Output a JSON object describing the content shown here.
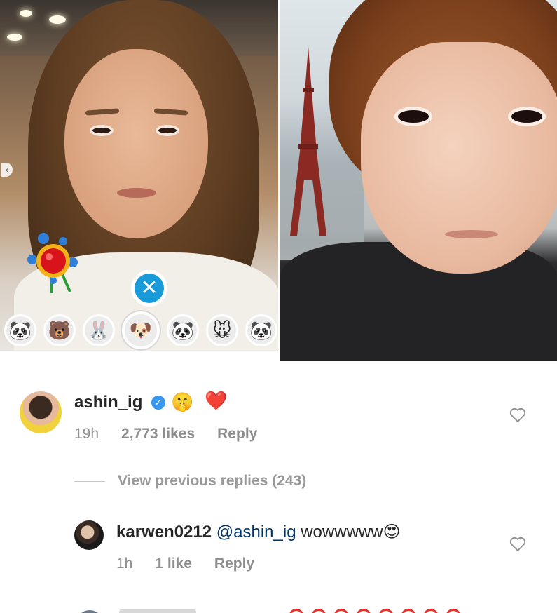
{
  "photos": {
    "left_alt": "",
    "filter_tray": {
      "chips": [
        "🐼",
        "🐻",
        "🐰",
        "🐶",
        "🐼",
        "🐭",
        "🐼"
      ],
      "selected_index": 3
    },
    "close_glyph": "✕",
    "chevron_glyph": "‹"
  },
  "main_comment": {
    "username": "ashin_ig",
    "verified_glyph": "✓",
    "emojis": [
      "🤫",
      "❤️"
    ],
    "time": "19h",
    "likes": "2,773 likes",
    "reply_label": "Reply",
    "like_icon": "heart-outline-icon"
  },
  "view_replies": {
    "label": "View previous replies (243)"
  },
  "reply_comment": {
    "username": "karwen0212",
    "mention": "@ashin_ig",
    "text": "wowwwww",
    "emoji": "😍",
    "time": "1h",
    "likes": "1 like",
    "reply_label": "Reply",
    "like_icon": "heart-outline-icon"
  },
  "colors": {
    "mention": "#003569",
    "verified": "#3897f0",
    "meta_text": "#8e8e8e",
    "close_button": "#1a9bd9"
  }
}
